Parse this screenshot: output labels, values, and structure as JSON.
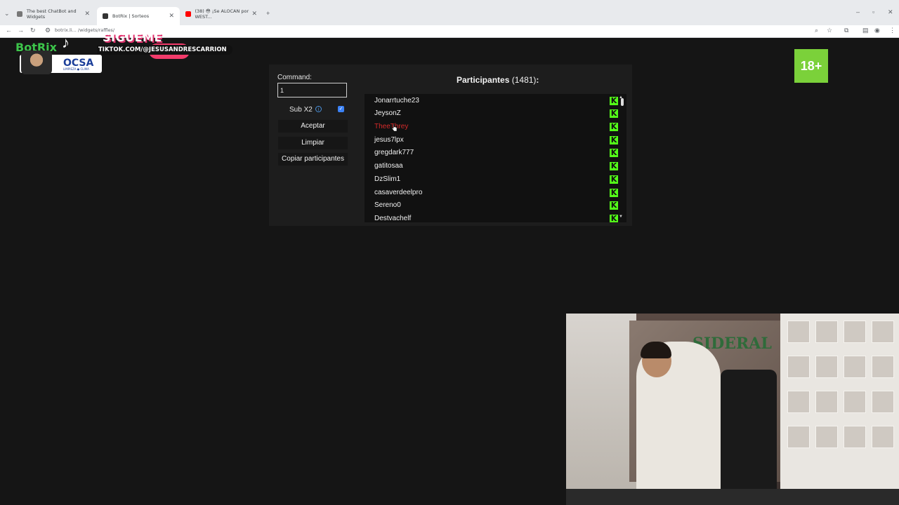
{
  "browser": {
    "tabs": [
      {
        "title": "The best ChatBot and Widgets",
        "active": false
      },
      {
        "title": "BotRix | Sorteos",
        "active": true
      },
      {
        "title": "(38) 😳 ¡Se ALOCAN por WEST...",
        "active": false
      }
    ],
    "url": "botrix.li... /widgets/raffles/"
  },
  "overlay": {
    "sigueme": "SIGUEME",
    "tiktok_handle": "TIKTOK.COM/@JESUSANDRESCARRION",
    "botrix": "BotRix",
    "ocsa": "OCSA",
    "ocsa_sub": "LIMPIEZA ● CLIMA",
    "age_badge": "18+"
  },
  "raffle": {
    "command_label": "Command:",
    "command_value": "1",
    "sub_label": "Sub X2",
    "sub_checked": true,
    "accept_label": "Aceptar",
    "clear_label": "Limpiar",
    "copy_label": "Copiar participantes",
    "participants_label": "Participantes",
    "participants_count": "(1481)",
    "participants_colon": ":",
    "participants": [
      {
        "name": "Jonarrtuche23",
        "highlight": false
      },
      {
        "name": "JeysonZ",
        "highlight": false
      },
      {
        "name": "TheeThrey",
        "highlight": true
      },
      {
        "name": "jesus7lpx",
        "highlight": false
      },
      {
        "name": "gregdark777",
        "highlight": false
      },
      {
        "name": "gatitosaa",
        "highlight": false
      },
      {
        "name": "DzSlim1",
        "highlight": false
      },
      {
        "name": "casaverdeelpro",
        "highlight": false
      },
      {
        "name": "Sereno0",
        "highlight": false
      },
      {
        "name": "Destvachelf",
        "highlight": false
      }
    ],
    "platform_icon": "kick-icon",
    "accent": "#53fc18",
    "highlight_color": "#d42a2a"
  },
  "webcam": {
    "logo_text": "SIDERAL"
  }
}
